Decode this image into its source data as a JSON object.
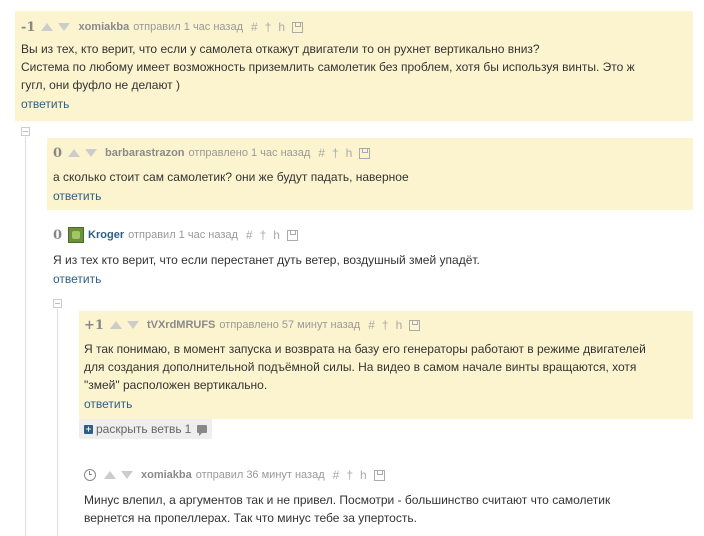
{
  "comments": [
    {
      "score": "-1",
      "author": "xomiakba",
      "meta": "отправил 1 час назад",
      "lines": [
        "Вы из тех, кто верит, что если у самолета откажут двигатели то он рухнет вертикально вниз?",
        "Система по любому имеет возможность приземлить самолетик без проблем, хотя бы используя винты. Это ж",
        "гугл, они фуфло не делают )"
      ],
      "reply": "ответить"
    },
    {
      "score": "0",
      "author": "barbarastrazon",
      "meta": "отправлено 1 час назад",
      "lines": [
        "а сколько стоит сам самолетик? они же будут падать, наверное"
      ],
      "reply": "ответить"
    },
    {
      "score": "0",
      "author": "Kroger",
      "meta": "отправил 1 час назад",
      "lines": [
        "Я из тех кто верит, что если перестанет дуть ветер, воздушный змей упадёт."
      ],
      "reply": "ответить"
    },
    {
      "score": "+1",
      "author": "tVXrdMRUFS",
      "meta": "отправлено 57 минут назад",
      "lines": [
        "Я так понимаю, в момент запуска и возврата на базу его генераторы работают в режиме двигателей",
        "для создания дополнительной подъёмной силы. На видео в самом начале винты вращаются, хотя",
        "\"змей\" расположен вертикально."
      ],
      "reply": "ответить"
    },
    {
      "author": "xomiakba",
      "meta": "отправил 36 минут назад",
      "lines": [
        "Минус влепил, а аргументов так и не привел. Посмотри - большинство считают что самолетик",
        "вернется на пропеллерах. Так что минус тебе за упертость."
      ]
    }
  ],
  "expand_branch": {
    "label": "раскрыть ветвь",
    "count": "1"
  },
  "tool_icons": [
    "#",
    "†",
    "h"
  ]
}
